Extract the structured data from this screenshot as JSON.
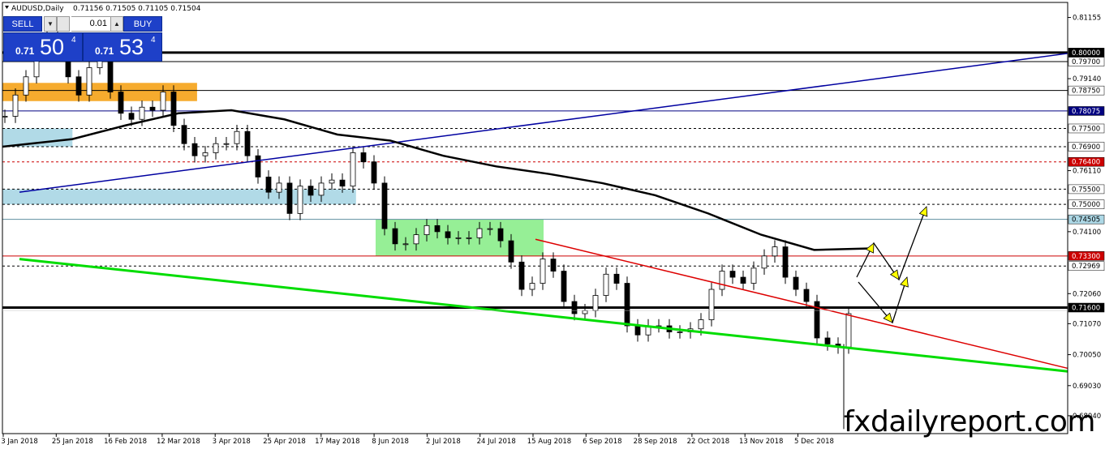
{
  "header": {
    "symbol": "AUDUSD,Daily",
    "ohlc": "0.71156 0.71505 0.71105 0.71504"
  },
  "trade_panel": {
    "sell_label": "SELL",
    "buy_label": "BUY",
    "lot_size": "0.01",
    "sell_price": {
      "prefix": "0.71",
      "big": "50",
      "sup": "4"
    },
    "buy_price": {
      "prefix": "0.71",
      "big": "53",
      "sup": "4"
    },
    "colors": {
      "panel": "#1e40c8"
    }
  },
  "watermark": "fxdailyreport.com",
  "chart_data": {
    "type": "candlestick",
    "title": "AUDUSD,Daily",
    "xlabel": "",
    "ylabel": "",
    "ylim": [
      0.6745,
      0.8165
    ],
    "date_labels": [
      "3 Jan 2018",
      "25 Jan 2018",
      "16 Feb 2018",
      "12 Mar 2018",
      "3 Apr 2018",
      "25 Apr 2018",
      "17 May 2018",
      "8 Jun 2018",
      "2 Jul 2018",
      "24 Jul 2018",
      "15 Aug 2018",
      "6 Sep 2018",
      "28 Sep 2018",
      "22 Oct 2018",
      "13 Nov 2018",
      "5 Dec 2018"
    ],
    "y_ticks": [
      "0.81155",
      "0.79140",
      "0.76110",
      "0.74100",
      "0.72060",
      "0.71070",
      "0.70050",
      "0.69030",
      "0.68040"
    ],
    "price_levels": [
      {
        "label": "0.80000",
        "value": 0.8,
        "style": "thick",
        "color": "#000000"
      },
      {
        "label": "0.79700",
        "value": 0.797,
        "style": "solid",
        "color": "#000000"
      },
      {
        "label": "0.78750",
        "value": 0.7875,
        "style": "solid",
        "color": "#000000"
      },
      {
        "label": "0.78075",
        "value": 0.78075,
        "style": "solid",
        "color": "#000080"
      },
      {
        "label": "0.77500",
        "value": 0.775,
        "style": "dash",
        "color": "#000000"
      },
      {
        "label": "0.76900",
        "value": 0.769,
        "style": "dash",
        "color": "#000000"
      },
      {
        "label": "0.76400",
        "value": 0.764,
        "style": "dash",
        "color": "#cc0000"
      },
      {
        "label": "0.75500",
        "value": 0.755,
        "style": "dash",
        "color": "#000000"
      },
      {
        "label": "0.75000",
        "value": 0.75,
        "style": "dash",
        "color": "#000000"
      },
      {
        "label": "0.74505",
        "value": 0.74505,
        "style": "solid",
        "color": "#5f8fa0"
      },
      {
        "label": "0.73300",
        "value": 0.733,
        "style": "solid",
        "color": "#cc0000"
      },
      {
        "label": "0.72969",
        "value": 0.72969,
        "style": "dash",
        "color": "#000000"
      },
      {
        "label": "0.71600",
        "value": 0.716,
        "style": "thick",
        "color": "#000000"
      }
    ],
    "current_price": 0.71504,
    "zones": [
      {
        "x0": "3 Jan 2018",
        "x1": "12 Mar 2018",
        "y0": 0.784,
        "y1": 0.79,
        "color": "#f5a623"
      },
      {
        "x0": "3 Jan 2018",
        "x1": "25 Jan 2018",
        "y0": 0.769,
        "y1": 0.775,
        "color": "#add8e6"
      },
      {
        "x0": "3 Jan 2018",
        "x1": "17 May 2018",
        "y0": 0.75,
        "y1": 0.755,
        "color": "#add8e6"
      },
      {
        "x0": "8 Jun 2018",
        "x1": "6 Aug 2018",
        "y0": 0.733,
        "y1": 0.745,
        "color": "#90ee90"
      }
    ],
    "close_series": [
      0.779,
      0.786,
      0.792,
      0.801,
      0.806,
      0.803,
      0.792,
      0.786,
      0.795,
      0.799,
      0.787,
      0.78,
      0.778,
      0.782,
      0.781,
      0.787,
      0.776,
      0.77,
      0.766,
      0.767,
      0.77,
      0.77,
      0.774,
      0.766,
      0.759,
      0.754,
      0.757,
      0.747,
      0.756,
      0.753,
      0.757,
      0.758,
      0.756,
      0.767,
      0.764,
      0.757,
      0.742,
      0.737,
      0.737,
      0.74,
      0.743,
      0.741,
      0.739,
      0.739,
      0.739,
      0.742,
      0.742,
      0.738,
      0.731,
      0.722,
      0.724,
      0.732,
      0.728,
      0.718,
      0.714,
      0.715,
      0.72,
      0.727,
      0.724,
      0.71,
      0.707,
      0.71,
      0.71,
      0.708,
      0.708,
      0.709,
      0.712,
      0.722,
      0.728,
      0.726,
      0.724,
      0.729,
      0.733,
      0.736,
      0.726,
      0.722,
      0.718,
      0.706,
      0.704,
      0.703,
      0.714
    ],
    "series": [
      {
        "name": "",
        "type": "moving-average",
        "points": [
          [
            "3 Jan 2018",
            0.769
          ],
          [
            "25 Jan 2018",
            0.7715
          ],
          [
            "16 Feb 2018",
            0.776
          ],
          [
            "12 Mar 2018",
            0.78
          ],
          [
            "3 Apr 2018",
            0.781
          ],
          [
            "25 Apr 2018",
            0.778
          ],
          [
            "17 May 2018",
            0.773
          ],
          [
            "8 Jun 2018",
            0.771
          ],
          [
            "2 Jul 2018",
            0.766
          ],
          [
            "24 Jul 2018",
            0.7625
          ],
          [
            "15 Aug 2018",
            0.76
          ],
          [
            "6 Sep 2018",
            0.757
          ],
          [
            "28 Sep 2018",
            0.753
          ],
          [
            "22 Oct 2018",
            0.747
          ],
          [
            "13 Nov 2018",
            0.74
          ],
          [
            "5 Dec 2018",
            0.735
          ]
        ],
        "color": "#000000"
      }
    ],
    "trendlines": [
      {
        "color": "#0000a0",
        "from": [
          "3 Jan 2018",
          0.754
        ],
        "to": [
          "right-edge",
          0.7997
        ]
      },
      {
        "color": "#00dd00",
        "from": [
          "3 Jan 2018",
          0.732
        ],
        "to": [
          "right-edge",
          0.695
        ]
      },
      {
        "color": "#dd0000",
        "from": [
          "15 Aug 2018",
          0.7385
        ],
        "to": [
          "right-edge",
          0.696
        ]
      }
    ],
    "projection_arrows": [
      {
        "color": "#ffff00",
        "points": [
          [
            "after 5 Dec 2018",
            0.718
          ],
          [
            "after 5 Dec 2018",
            0.73
          ],
          [
            "after 5 Dec 2018",
            0.7165
          ],
          [
            "after 5 Dec 2018",
            0.744
          ]
        ]
      },
      {
        "color": "#ffff00",
        "points": [
          [
            "after 5 Dec 2018",
            0.7165
          ],
          [
            "after 5 Dec 2018",
            0.702
          ],
          [
            "after 5 Dec 2018",
            0.7165
          ]
        ]
      }
    ],
    "grid": false,
    "legend": "none"
  }
}
